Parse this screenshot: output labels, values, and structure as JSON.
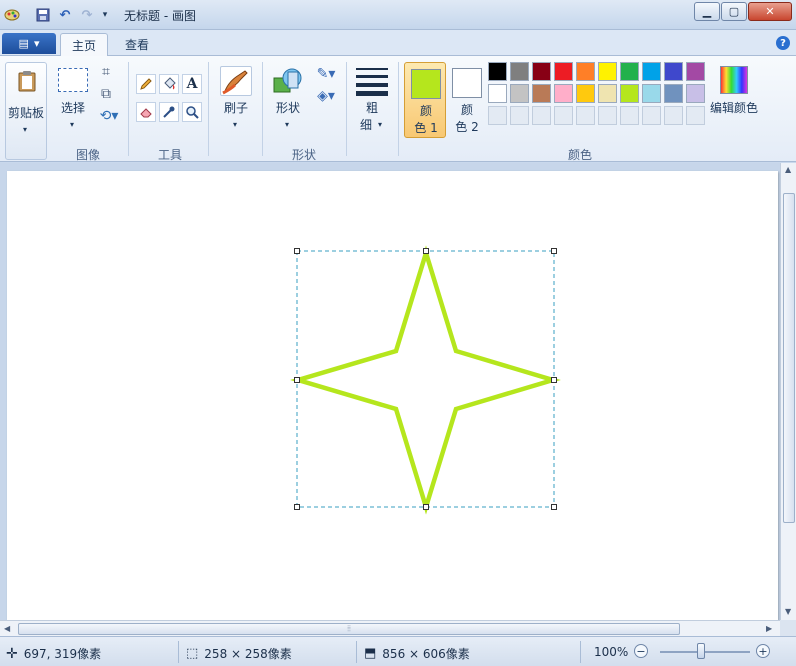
{
  "window": {
    "title": "无标题 - 画图",
    "minimize_icon": "minimize-icon",
    "maximize_icon": "maximize-icon",
    "close_icon": "close-icon"
  },
  "tabs": [
    {
      "label": "主页",
      "active": true
    },
    {
      "label": "查看",
      "active": false
    }
  ],
  "ribbon": {
    "clipboard": {
      "label": "剪贴板"
    },
    "image": {
      "select_label": "选择",
      "group_label": "图像"
    },
    "tools": {
      "group_label": "工具"
    },
    "brush": {
      "label": "刷子"
    },
    "shapes": {
      "label": "形状",
      "group_label": "形状"
    },
    "size": {
      "label_line1": "粗",
      "label_line2": "细"
    },
    "colors": {
      "color1_line1": "颜",
      "color1_line2": "色 1",
      "color2_line1": "颜",
      "color2_line2": "色 2",
      "edit_label": "编辑颜色",
      "group_label": "颜色",
      "color1_value": "#b5e61d",
      "color2_value": "#ffffff",
      "palette_row1": [
        "#000000",
        "#7f7f7f",
        "#880015",
        "#ed1c24",
        "#ff7f27",
        "#fff200",
        "#22b14c",
        "#00a2e8",
        "#3f48cc",
        "#a349a4"
      ],
      "palette_row2": [
        "#ffffff",
        "#c3c3c3",
        "#b97a57",
        "#ffaec9",
        "#ffc90e",
        "#efe4b0",
        "#b5e61d",
        "#99d9ea",
        "#7092be",
        "#c8bfe7"
      ]
    }
  },
  "canvas": {
    "shape": "four-point-star",
    "stroke_color": "#b5e61d"
  },
  "statusbar": {
    "cursor_pos": "697, 319像素",
    "selection_size": "258 × 258像素",
    "image_size": "856 × 606像素",
    "zoom": "100%"
  }
}
